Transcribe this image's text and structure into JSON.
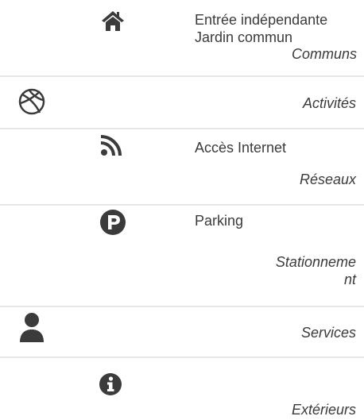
{
  "rows": [
    {
      "label": "Communs",
      "icon": "home-icon",
      "values": [
        "Entrée indépendante",
        "Jardin commun"
      ]
    },
    {
      "label": "Activités",
      "icon": "basketball-icon",
      "values": []
    },
    {
      "label": "Réseaux",
      "icon": "rss-icon",
      "values": [
        "Accès Internet"
      ]
    },
    {
      "label": "Stationnement",
      "icon": "parking-icon",
      "values": [
        "Parking"
      ]
    },
    {
      "label": "Services",
      "icon": "user-icon",
      "values": []
    },
    {
      "label": "Extérieurs",
      "icon": "info-icon",
      "values": []
    }
  ]
}
